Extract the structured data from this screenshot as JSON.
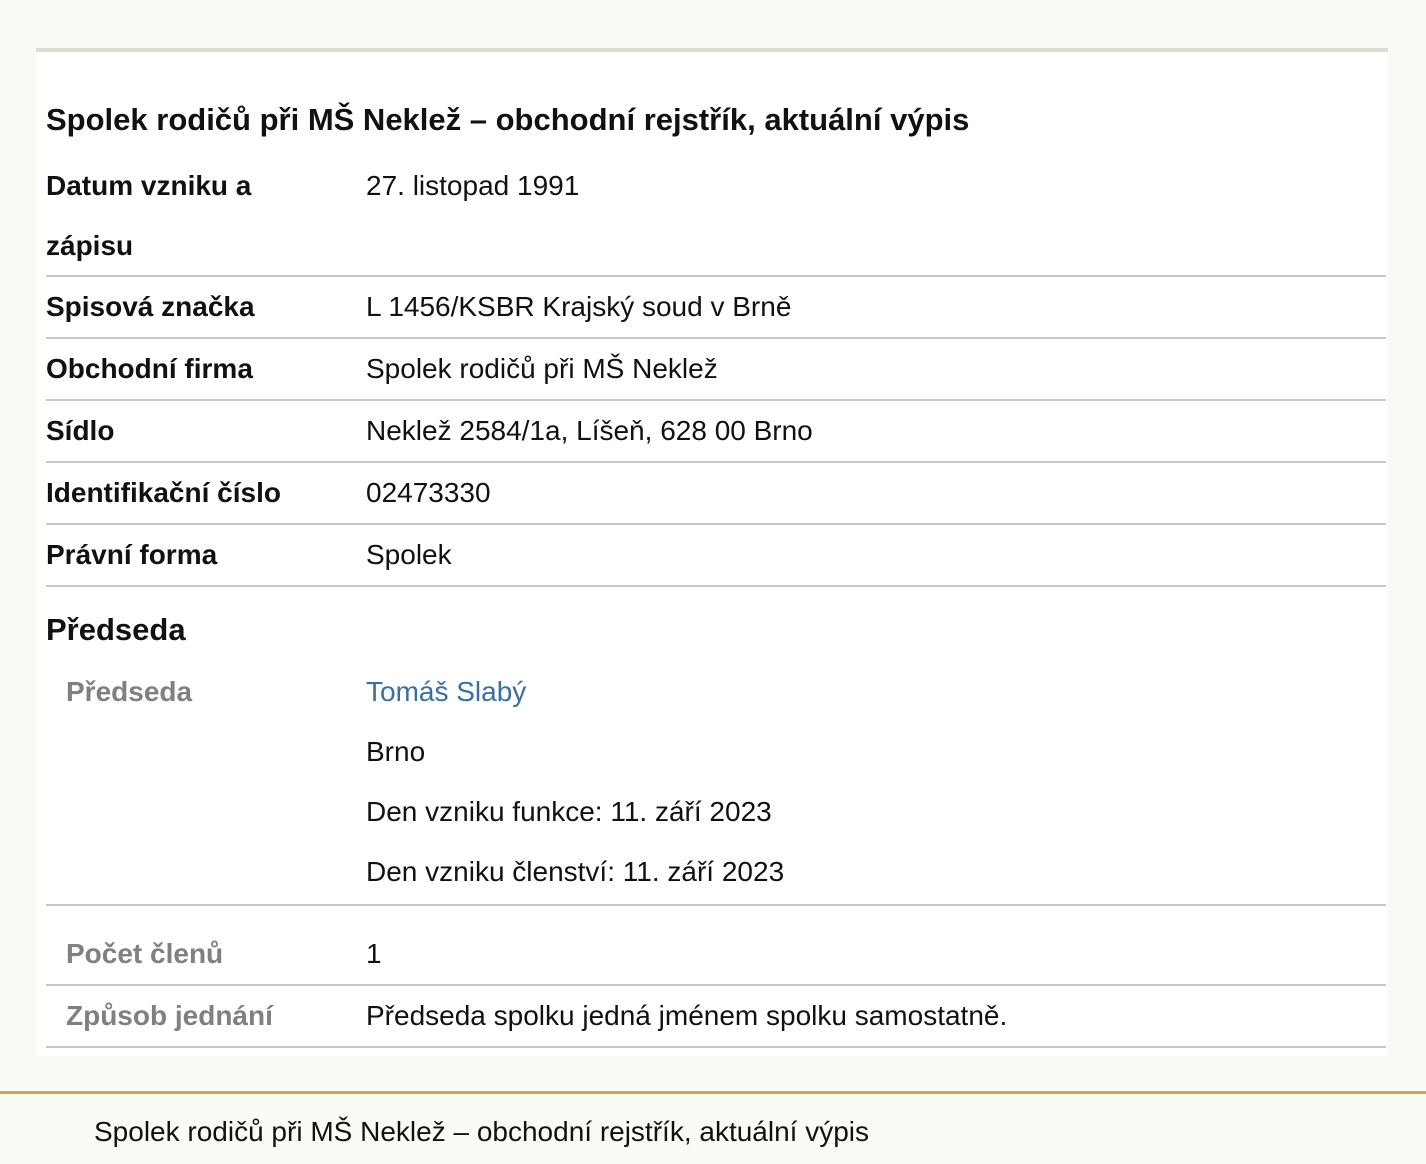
{
  "document": {
    "title": "Spolek rodičů při MŠ Neklež – obchodní rejstřík, aktuální výpis"
  },
  "fields": [
    {
      "label": "Datum vzniku a zápisu",
      "value": "27. listopad 1991"
    },
    {
      "label": "Spisová značka",
      "value": "L 1456/KSBR Krajský soud v Brně"
    },
    {
      "label": "Obchodní firma",
      "value": "Spolek rodičů při MŠ Neklež"
    },
    {
      "label": "Sídlo",
      "value": "Neklež 2584/1a, Líšeň, 628 00 Brno"
    },
    {
      "label": "Identifikační číslo",
      "value": "02473330"
    },
    {
      "label": "Právní forma",
      "value": "Spolek"
    }
  ],
  "board": {
    "heading": "Předseda",
    "person": {
      "role": "Předseda",
      "name": "Tomáš Slabý",
      "city": "Brno",
      "function_start": "Den vzniku funkce: 11. září 2023",
      "membership_start": "Den vzniku členství: 11. září 2023"
    },
    "member_count": {
      "label": "Počet členů",
      "value": "1"
    },
    "representation": {
      "label": "Způsob jednání",
      "value": "Předseda spolku jedná jménem spolku samostatně."
    }
  },
  "footer": {
    "text": "Spolek rodičů při MŠ Neklež – obchodní rejstřík, aktuální výpis"
  }
}
